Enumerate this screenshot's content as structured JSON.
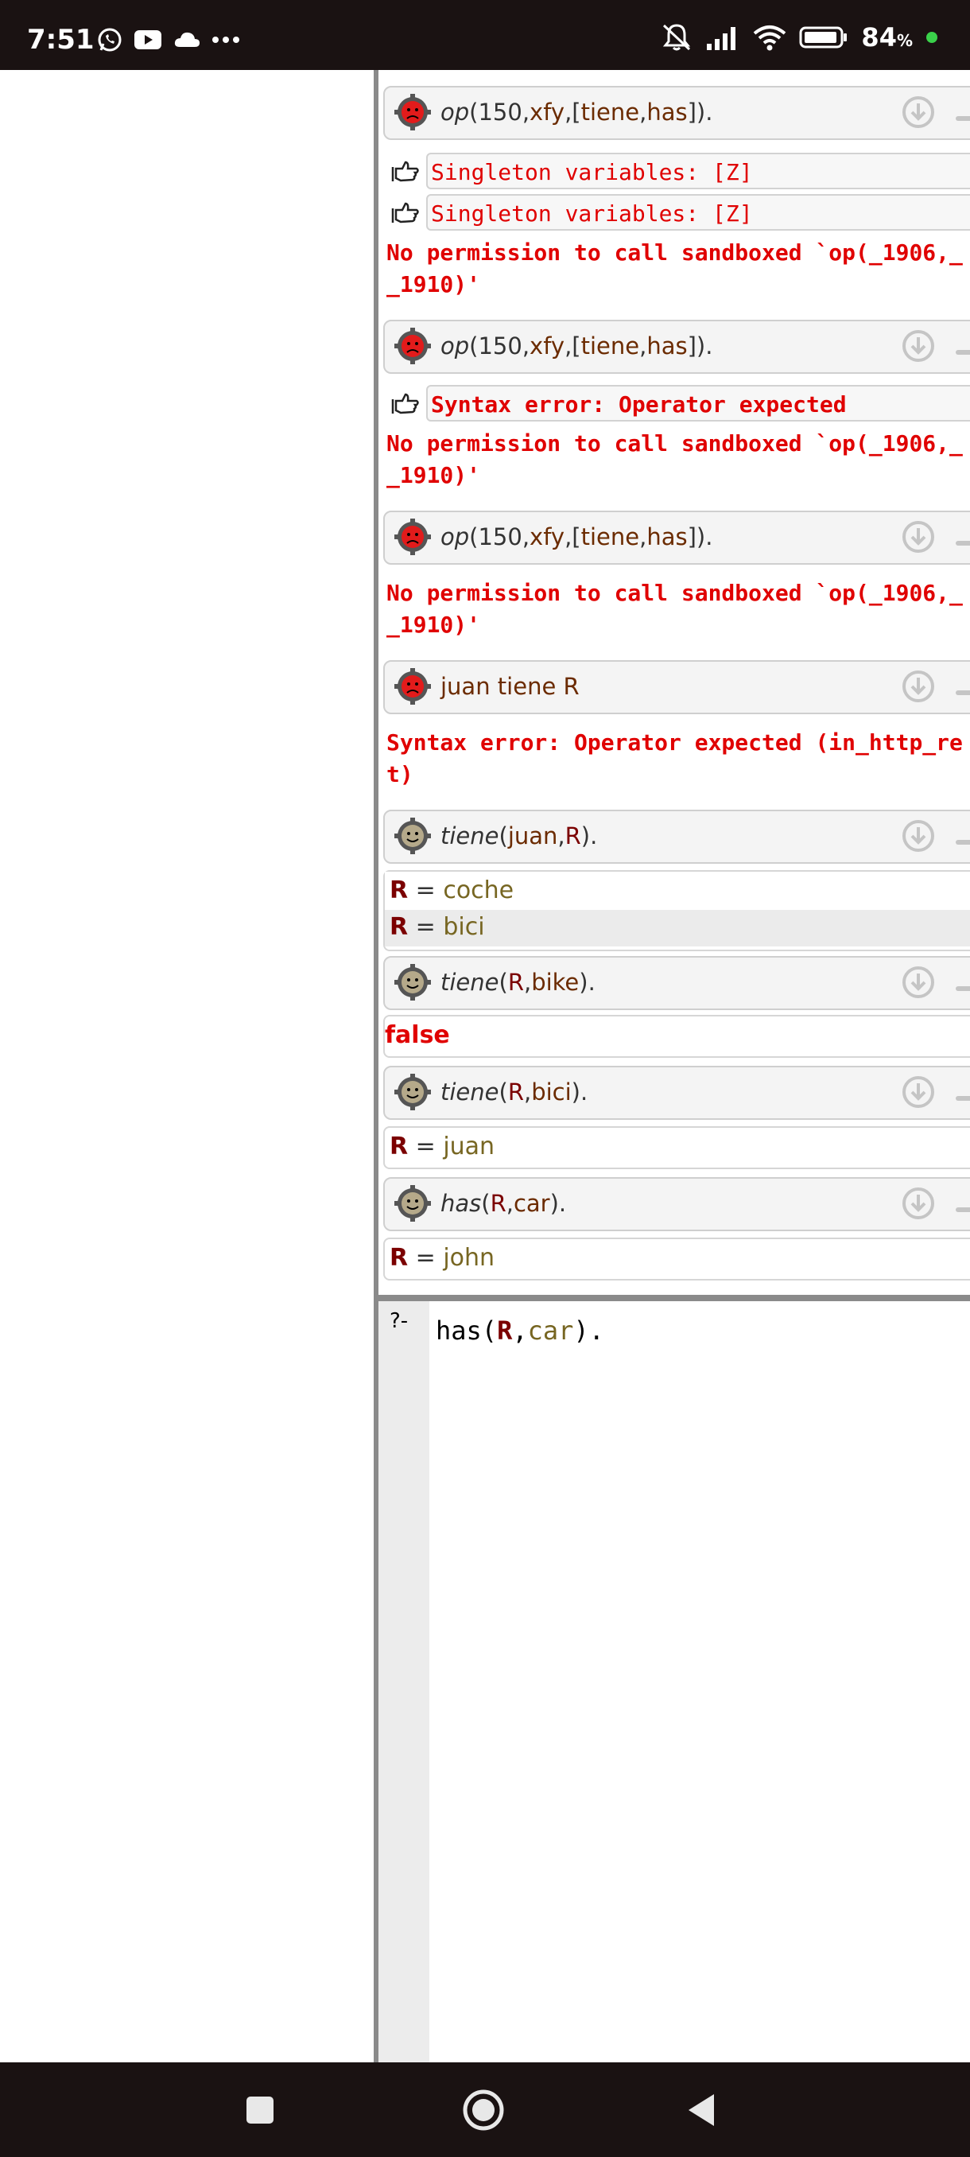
{
  "status_bar": {
    "time": "7:51",
    "battery": "84",
    "battery_unit": "%"
  },
  "results": [
    {
      "kind": "query",
      "state": "error",
      "fn": "op",
      "args_html": [
        "150",
        "xfy",
        "[tiene,has]"
      ],
      "text": "op(150,xfy,[tiene,has])."
    },
    {
      "kind": "warn",
      "text": "Singleton variables: [Z]"
    },
    {
      "kind": "warn",
      "text": "Singleton variables: [Z]"
    },
    {
      "kind": "error",
      "line1": "No permission to call sandboxed `op(_1906,_",
      "line2": "_1910)'"
    },
    {
      "kind": "query",
      "state": "error",
      "text": "op(150,xfy,[tiene,has])."
    },
    {
      "kind": "warn",
      "text": "Syntax error: Operator expected"
    },
    {
      "kind": "error",
      "line1": "No permission to call sandboxed `op(_1906,_",
      "line2": "_1910)'"
    },
    {
      "kind": "query",
      "state": "error",
      "text": "op(150,xfy,[tiene,has])."
    },
    {
      "kind": "error",
      "line1": "No permission to call sandboxed `op(_1906,_",
      "line2": "_1910)'"
    },
    {
      "kind": "query",
      "state": "error",
      "text": "juan tiene R"
    },
    {
      "kind": "error",
      "line1": "Syntax error: Operator expected (in_http_re",
      "line2": "t)"
    },
    {
      "kind": "query",
      "state": "ok",
      "text": "tiene(juan,R)."
    },
    {
      "kind": "answer",
      "var": "R",
      "eq": " = ",
      "val": "coche"
    },
    {
      "kind": "answer",
      "var": "R",
      "eq": " = ",
      "val": "bici"
    },
    {
      "kind": "query",
      "state": "ok",
      "text": "tiene(R,bike)."
    },
    {
      "kind": "false",
      "text": "false"
    },
    {
      "kind": "query",
      "state": "ok",
      "text": "tiene(R,bici)."
    },
    {
      "kind": "answer",
      "var": "R",
      "eq": " = ",
      "val": "juan"
    },
    {
      "kind": "query",
      "state": "ok",
      "text": "has(R,car)."
    },
    {
      "kind": "answer",
      "var": "R",
      "eq": " = ",
      "val": "john"
    }
  ],
  "editor": {
    "prompt": "?-",
    "code_fn": "has(",
    "code_var": "R",
    "code_comma": ",",
    "code_atom": "car",
    "code_end": ")."
  },
  "colors": {
    "error_red": "#e00000",
    "variable": "#7b0000",
    "atom": "#6b2b00"
  },
  "icons": {
    "error_query": "sad-gear-icon",
    "ok_query": "happy-gear-icon",
    "download": "download-circle-icon",
    "warning": "pointing-hand-icon",
    "nav_recents": "square-icon",
    "nav_home": "circle-icon",
    "nav_back": "triangle-back-icon"
  }
}
